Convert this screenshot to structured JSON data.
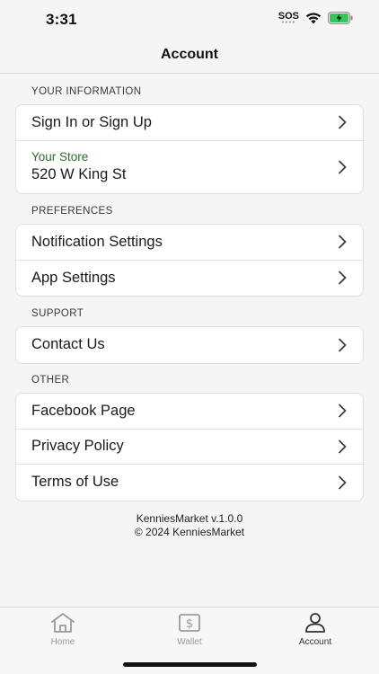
{
  "status": {
    "time": "3:31",
    "carrier": "SOS"
  },
  "header": {
    "title": "Account"
  },
  "sections": {
    "info": {
      "label": "YOUR INFORMATION",
      "sign_in": "Sign In or Sign Up",
      "store_title": "Your Store",
      "store_address": "520 W King St"
    },
    "preferences": {
      "label": "PREFERENCES",
      "notifications": "Notification Settings",
      "app_settings": "App Settings"
    },
    "support": {
      "label": "SUPPORT",
      "contact": "Contact Us"
    },
    "other": {
      "label": "OTHER",
      "facebook": "Facebook Page",
      "privacy": "Privacy Policy",
      "terms": "Terms of Use"
    }
  },
  "footer": {
    "version": "KenniesMarket v.1.0.0",
    "copyright": "© 2024 KenniesMarket"
  },
  "tabs": {
    "home": "Home",
    "wallet": "Wallet",
    "account": "Account",
    "active": "account"
  },
  "colors": {
    "accent_green": "#2e6b33",
    "background": "#f5f5f5",
    "battery_green": "#34c759"
  },
  "icons": [
    "signal-icon",
    "wifi-icon",
    "battery-icon",
    "chevron-right-icon",
    "home-icon",
    "wallet-icon",
    "person-icon"
  ]
}
